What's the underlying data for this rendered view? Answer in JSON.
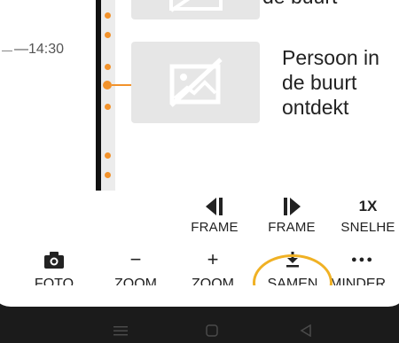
{
  "timeline": {
    "time_label": "—14:30",
    "previous_event_text": "de buurt",
    "event_title": "Persoon in\nde buurt\nontdekt",
    "accent_color": "#f2922b",
    "thumbnail_icon": "image-placeholder-icon"
  },
  "playback_controls": [
    {
      "icon": "previous-frame-icon",
      "label": "FRAME"
    },
    {
      "icon": "next-frame-icon",
      "label": "FRAME"
    },
    {
      "icon_text": "1X",
      "label": "SNELHE"
    }
  ],
  "actions": [
    {
      "icon": "camera-icon",
      "label": "FOTO"
    },
    {
      "icon_text": "−",
      "label": "ZOOM"
    },
    {
      "icon_text": "+",
      "label": "ZOOM"
    },
    {
      "icon": "download-icon",
      "label": "SAMEN"
    },
    {
      "icon_text": "●●●",
      "label": "MINDER"
    }
  ],
  "highlight_color": "#f0b124",
  "navbar": {
    "icons": [
      "menu-icon",
      "home-icon",
      "back-icon"
    ]
  }
}
